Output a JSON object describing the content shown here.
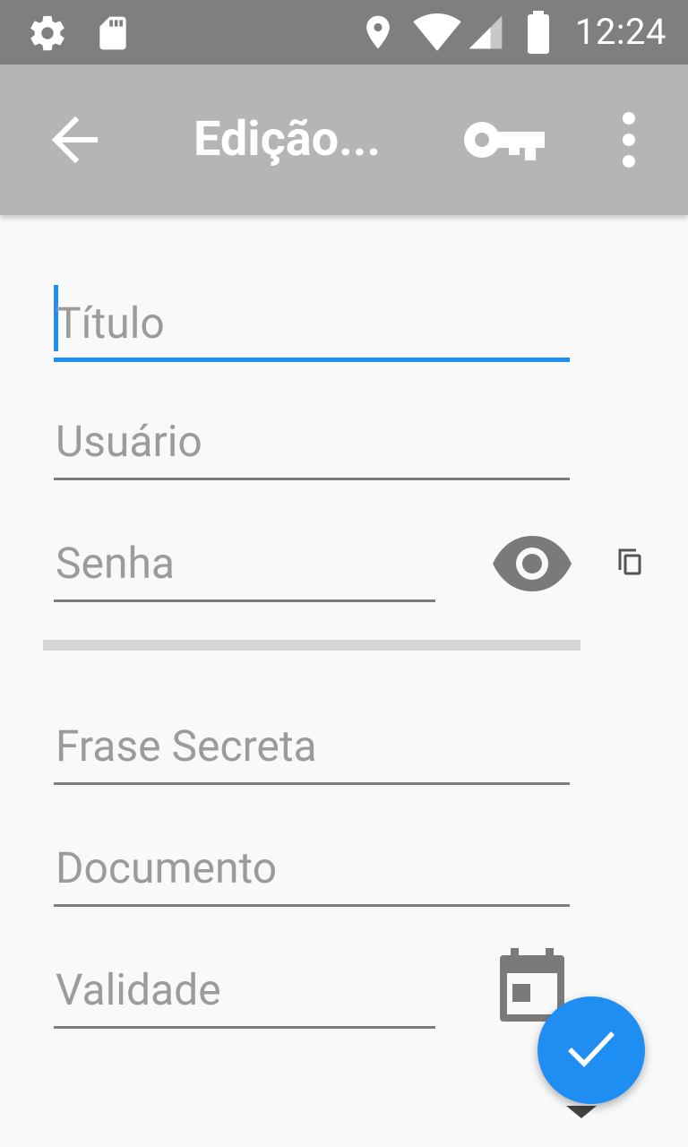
{
  "status_bar": {
    "time": "12:24",
    "icons": [
      "settings-icon",
      "sd-card-icon",
      "location-icon",
      "wifi-icon",
      "cell-signal-icon",
      "battery-icon"
    ]
  },
  "toolbar": {
    "title": "Edição...",
    "back_icon": "arrow-back-icon",
    "key_icon": "key-icon",
    "more_icon": "more-vert-icon"
  },
  "form": {
    "titulo": {
      "placeholder": "Título",
      "focused": true
    },
    "usuario": {
      "placeholder": "Usuário"
    },
    "senha": {
      "placeholder": "Senha",
      "visibility_icon": "eye-icon",
      "copy_icon": "copy-icon"
    },
    "frase_secreta": {
      "placeholder": "Frase Secreta"
    },
    "documento": {
      "placeholder": "Documento"
    },
    "validade": {
      "placeholder": "Validade",
      "date_icon": "calendar-icon"
    }
  },
  "fab": {
    "icon": "check-icon"
  },
  "colors": {
    "accent": "#1e8ef2",
    "toolbar": "#b5b5b5",
    "status_bar": "#7f7f7f",
    "background": "#f9f9f9",
    "hint_text": "#9b9b9b",
    "icon_gray": "#7a7a7a"
  }
}
